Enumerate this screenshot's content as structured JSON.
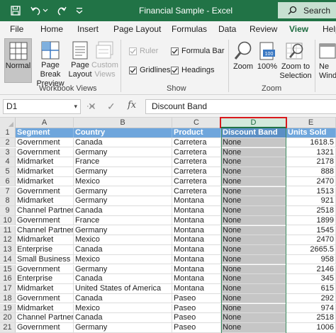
{
  "titlebar": {
    "title": "Financial Sample  -  Excel",
    "search_label": "Search"
  },
  "tabs": [
    "File",
    "Home",
    "Insert",
    "Page Layout",
    "Formulas",
    "Data",
    "Review",
    "View",
    "Help"
  ],
  "active_tab": "View",
  "ribbon": {
    "workbook_views": {
      "label": "Workbook Views",
      "normal": "Normal",
      "page_break_1": "Page Break",
      "page_break_2": "Preview",
      "page_layout_1": "Page",
      "page_layout_2": "Layout",
      "custom_1": "Custom",
      "custom_2": "Views"
    },
    "show": {
      "label": "Show",
      "ruler": "Ruler",
      "gridlines": "Gridlines",
      "formula_bar": "Formula Bar",
      "headings": "Headings"
    },
    "zoom": {
      "label": "Zoom",
      "zoom": "Zoom",
      "zoom_100": "100%",
      "zoom_icon_text": "100",
      "zoom_sel_1": "Zoom to",
      "zoom_sel_2": "Selection"
    },
    "window": {
      "new_1": "Ne",
      "new_2": "Wind"
    }
  },
  "formula_bar": {
    "name_box": "D1",
    "formula": "Discount Band"
  },
  "columns": [
    "A",
    "B",
    "C",
    "D",
    "E"
  ],
  "selected_column": "D",
  "table": {
    "headers": [
      "Segment",
      "Country",
      "Product",
      "Discount Band",
      "Units Sold"
    ],
    "rows": [
      [
        "Government",
        "Canada",
        "Carretera",
        "None",
        "1618.5"
      ],
      [
        "Government",
        "Germany",
        "Carretera",
        "None",
        "1321"
      ],
      [
        "Midmarket",
        "France",
        "Carretera",
        "None",
        "2178"
      ],
      [
        "Midmarket",
        "Germany",
        "Carretera",
        "None",
        "888"
      ],
      [
        "Midmarket",
        "Mexico",
        "Carretera",
        "None",
        "2470"
      ],
      [
        "Government",
        "Germany",
        "Carretera",
        "None",
        "1513"
      ],
      [
        "Midmarket",
        "Germany",
        "Montana",
        "None",
        "921"
      ],
      [
        "Channel Partners",
        "Canada",
        "Montana",
        "None",
        "2518"
      ],
      [
        "Government",
        "France",
        "Montana",
        "None",
        "1899"
      ],
      [
        "Channel Partners",
        "Germany",
        "Montana",
        "None",
        "1545"
      ],
      [
        "Midmarket",
        "Mexico",
        "Montana",
        "None",
        "2470"
      ],
      [
        "Enterprise",
        "Canada",
        "Montana",
        "None",
        "2665.5"
      ],
      [
        "Small Business",
        "Mexico",
        "Montana",
        "None",
        "958"
      ],
      [
        "Government",
        "Germany",
        "Montana",
        "None",
        "2146"
      ],
      [
        "Enterprise",
        "Canada",
        "Montana",
        "None",
        "345"
      ],
      [
        "Midmarket",
        "United States of America",
        "Montana",
        "None",
        "615"
      ],
      [
        "Government",
        "Canada",
        "Paseo",
        "None",
        "292"
      ],
      [
        "Midmarket",
        "Mexico",
        "Paseo",
        "None",
        "974"
      ],
      [
        "Channel Partners",
        "Canada",
        "Paseo",
        "None",
        "2518"
      ],
      [
        "Government",
        "Germany",
        "Paseo",
        "None",
        "1006"
      ]
    ]
  }
}
